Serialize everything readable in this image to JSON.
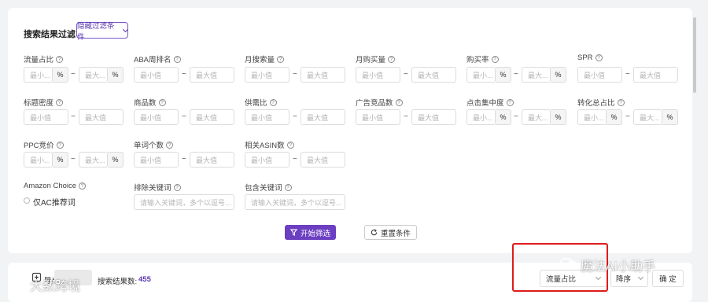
{
  "filter": {
    "title": "搜索结果过滤",
    "hide_button": "隐藏过滤条件",
    "fields": {
      "traffic_share": {
        "label": "流量占比",
        "min": "最小...",
        "max": "最大...",
        "unit": "%"
      },
      "aba_rank": {
        "label": "ABA周排名",
        "min": "最小值",
        "max": "最大值"
      },
      "monthly_search": {
        "label": "月搜索量",
        "min": "最小值",
        "max": "最大值"
      },
      "monthly_purchase": {
        "label": "月购买量",
        "min": "最小值",
        "max": "最大值"
      },
      "purchase_rate": {
        "label": "购买率",
        "min": "最小...",
        "max": "最大...",
        "unit": "%"
      },
      "spr": {
        "label": "SPR",
        "min": "最小值",
        "max": "最大值"
      },
      "title_density": {
        "label": "标题密度",
        "min": "最小值",
        "max": "最大值"
      },
      "product_count": {
        "label": "商品数",
        "min": "最小值",
        "max": "最大值"
      },
      "supply_demand": {
        "label": "供需比",
        "min": "最小值",
        "max": "最大值"
      },
      "ad_products": {
        "label": "广告竞品数",
        "min": "最小值",
        "max": "最大值"
      },
      "click_concentration": {
        "label": "点击集中度",
        "min": "最小...",
        "max": "最大...",
        "unit": "%"
      },
      "conversion_share": {
        "label": "转化总占比",
        "min": "最小...",
        "max": "最大...",
        "unit": "%"
      },
      "ppc_bid": {
        "label": "PPC竞价",
        "min": "最小...",
        "max": "最大...",
        "unit": "%"
      },
      "word_count": {
        "label": "单词个数",
        "min": "最小值",
        "max": "最大值"
      },
      "related_asin": {
        "label": "相关ASIN数",
        "min": "最小值",
        "max": "最大值"
      },
      "amazon_choice": {
        "label": "Amazon Choice",
        "option": "仅AC推荐词"
      },
      "exclude_keywords": {
        "label": "排除关键词",
        "placeholder": "请输入关键词，多个以逗号..."
      },
      "include_keywords": {
        "label": "包含关键词",
        "placeholder": "请输入关键词，多个以逗号..."
      }
    },
    "start_button": "开始筛选",
    "reset_button": "重置条件"
  },
  "results": {
    "export_label": "导出",
    "count_label": "搜索结果数:",
    "count": "455",
    "sort_field": "流量占比",
    "sort_order": "降序",
    "confirm": "确 定"
  },
  "watermark": {
    "right": "魔法AI小助手",
    "left": "大数跨境"
  },
  "colors": {
    "accent": "#6c3fc2",
    "highlight": "#e01b1b"
  },
  "icons": [
    "help-icon",
    "chevron-down-icon",
    "filter-icon",
    "refresh-icon",
    "export-icon",
    "wechat-icon"
  ]
}
